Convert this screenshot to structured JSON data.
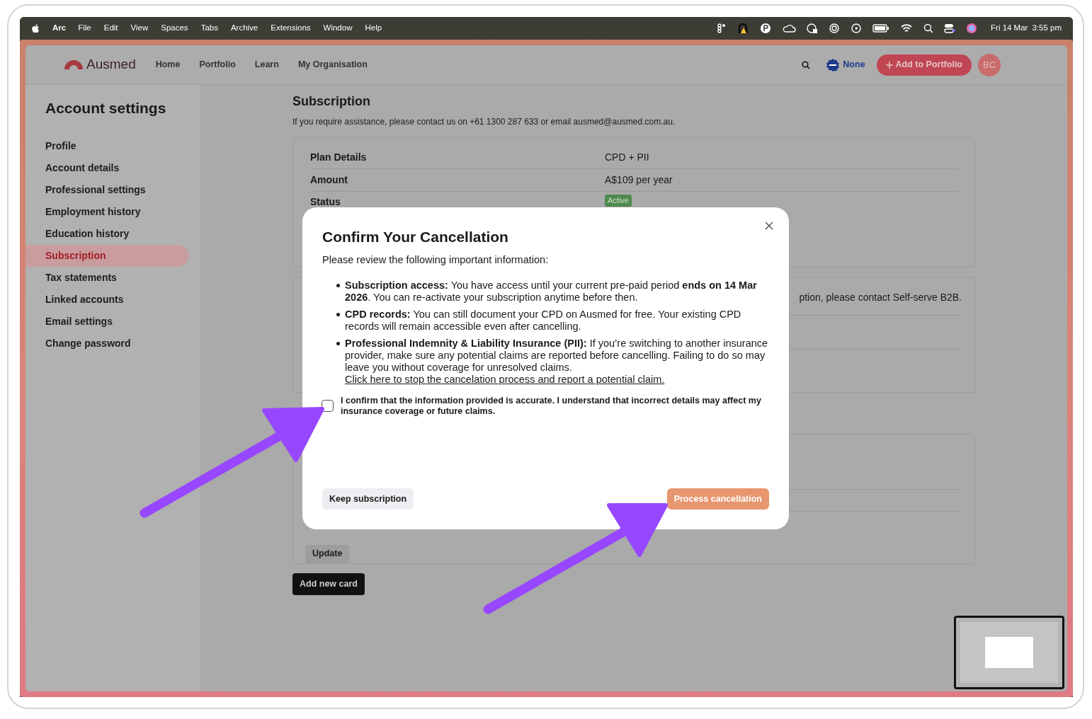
{
  "menu_bar": {
    "app": "Arc",
    "items": [
      "File",
      "Edit",
      "View",
      "Spaces",
      "Tabs",
      "Archive",
      "Extensions",
      "Window",
      "Help"
    ],
    "date": "Fri 14 Mar",
    "time": "3:55 pm"
  },
  "header": {
    "logo": "Ausmed",
    "nav": [
      "Home",
      "Portfolio",
      "Learn",
      "My Organisation"
    ],
    "cpd_status": "None",
    "add_button": "Add to Portfolio",
    "avatar": "BC"
  },
  "sidebar": {
    "title": "Account settings",
    "items": [
      {
        "label": "Profile",
        "selected": false
      },
      {
        "label": "Account details",
        "selected": false
      },
      {
        "label": "Professional settings",
        "selected": false
      },
      {
        "label": "Employment history",
        "selected": false
      },
      {
        "label": "Education history",
        "selected": false
      },
      {
        "label": "Subscription",
        "selected": true
      },
      {
        "label": "Tax statements",
        "selected": false
      },
      {
        "label": "Linked accounts",
        "selected": false
      },
      {
        "label": "Email settings",
        "selected": false
      },
      {
        "label": "Change password",
        "selected": false
      }
    ]
  },
  "main": {
    "title": "Subscription",
    "contact_text": "If you require assistance, please contact us on +61 1300 287 633 or email ausmed@ausmed.com.au.",
    "plan_rows": [
      {
        "label": "Plan Details",
        "value": "CPD + PII"
      },
      {
        "label": "Amount",
        "value": "A$109 per year"
      }
    ],
    "status": {
      "label": "Status",
      "value": "Active"
    },
    "b2b_text": "ption, please contact Self-serve B2B.",
    "update_button": "Update",
    "add_card_button": "Add new card"
  },
  "modal": {
    "title": "Confirm Your Cancellation",
    "intro": "Please review the following important information:",
    "bullets": [
      {
        "text": "**Subscription access:** You have access until your current pre-paid period **ends on 14 Mar 2026**. You can re-activate your subscription anytime before then."
      },
      {
        "text": "**CPD records:** You can still document your CPD on Ausmed for free. Your existing CPD records will remain accessible even after cancelling."
      },
      {
        "text": "**Professional Indemnity & Liability Insurance (PII):** If you’re switching to another insurance provider, make sure any potential claims are reported before cancelling. Failing to do so may leave you without coverage for unresolved claims.",
        "link": "Click here to stop the cancelation process and report a potential claim."
      }
    ],
    "confirm": {
      "label": "I confirm that the information provided is accurate. I understand that incorrect details may affect my insurance coverage or future claims.",
      "checked": false
    },
    "keep_button": "Keep subscription",
    "process_button": {
      "label": "Process cancellation",
      "disabled": true
    }
  }
}
